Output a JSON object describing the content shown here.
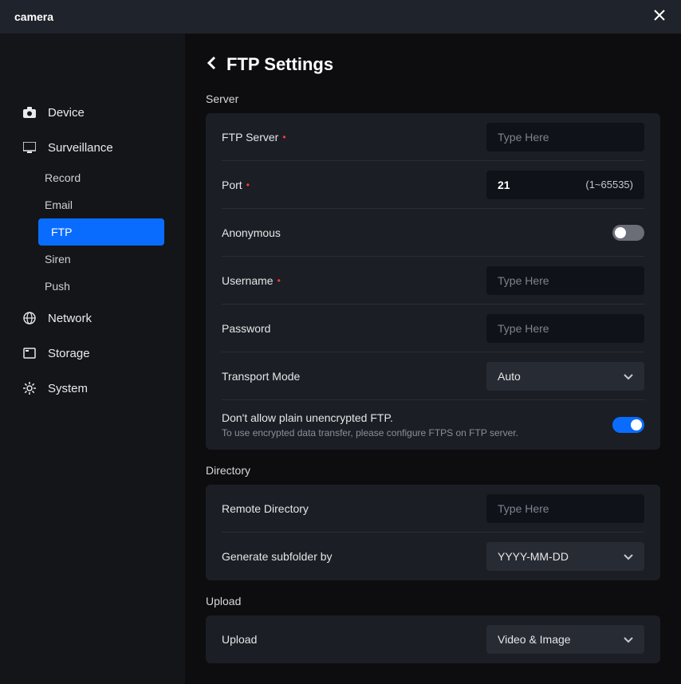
{
  "window": {
    "title": "camera"
  },
  "sidebar": {
    "device": "Device",
    "surveillance": "Surveillance",
    "surveillance_items": {
      "record": "Record",
      "email": "Email",
      "ftp": "FTP",
      "siren": "Siren",
      "push": "Push"
    },
    "network": "Network",
    "storage": "Storage",
    "system": "System"
  },
  "page": {
    "title": "FTP Settings"
  },
  "server": {
    "section": "Server",
    "ftp_server_label": "FTP Server",
    "ftp_server_placeholder": "Type Here",
    "port_label": "Port",
    "port_value": "21",
    "port_hint": "(1~65535)",
    "anonymous_label": "Anonymous",
    "username_label": "Username",
    "username_placeholder": "Type Here",
    "password_label": "Password",
    "password_placeholder": "Type Here",
    "transport_label": "Transport Mode",
    "transport_value": "Auto",
    "noplain_label": "Don't allow plain unencrypted FTP.",
    "noplain_desc": "To use encrypted data transfer, please configure FTPS on FTP server."
  },
  "directory": {
    "section": "Directory",
    "remote_label": "Remote Directory",
    "remote_placeholder": "Type Here",
    "subfolder_label": "Generate subfolder by",
    "subfolder_value": "YYYY-MM-DD"
  },
  "upload": {
    "section": "Upload",
    "upload_label": "Upload",
    "upload_value": "Video & Image"
  }
}
